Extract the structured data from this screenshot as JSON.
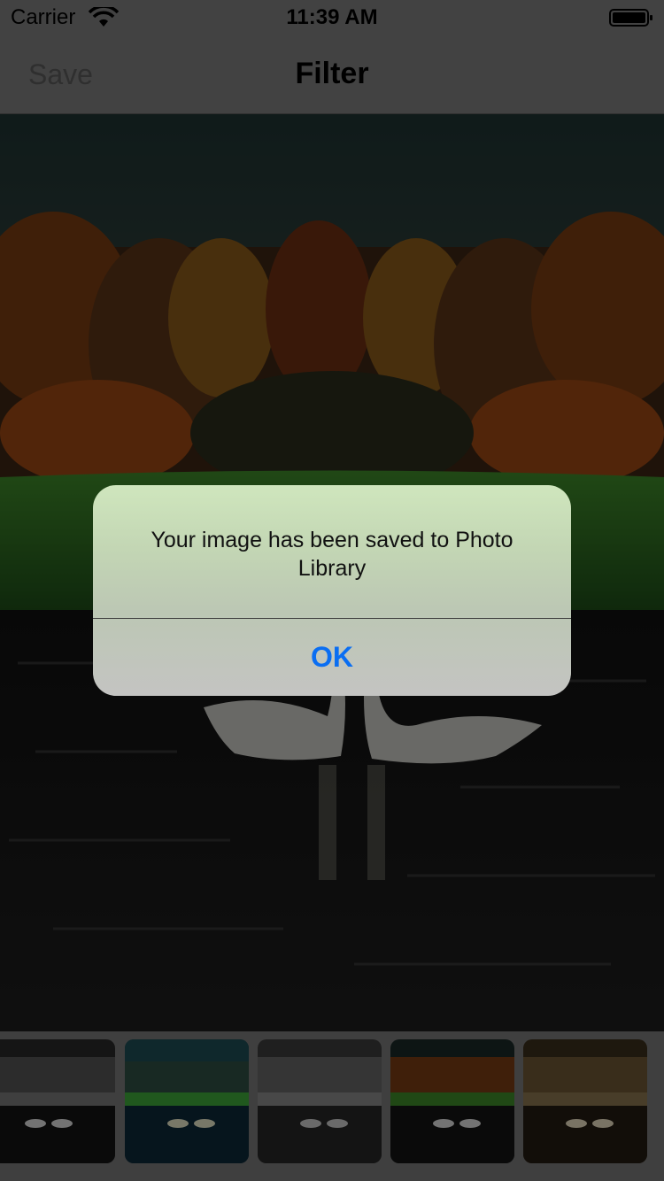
{
  "status_bar": {
    "carrier": "Carrier",
    "time": "11:39 AM"
  },
  "nav_bar": {
    "save_label": "Save",
    "title": "Filter"
  },
  "alert": {
    "message": "Your image has been saved to Photo Library",
    "ok_label": "OK"
  },
  "filters": {
    "thumbnail_tints": [
      "grayscale",
      "cool-teal",
      "faded-gray",
      "original",
      "sepia"
    ]
  },
  "colors": {
    "accent": "#0a6ef2"
  }
}
